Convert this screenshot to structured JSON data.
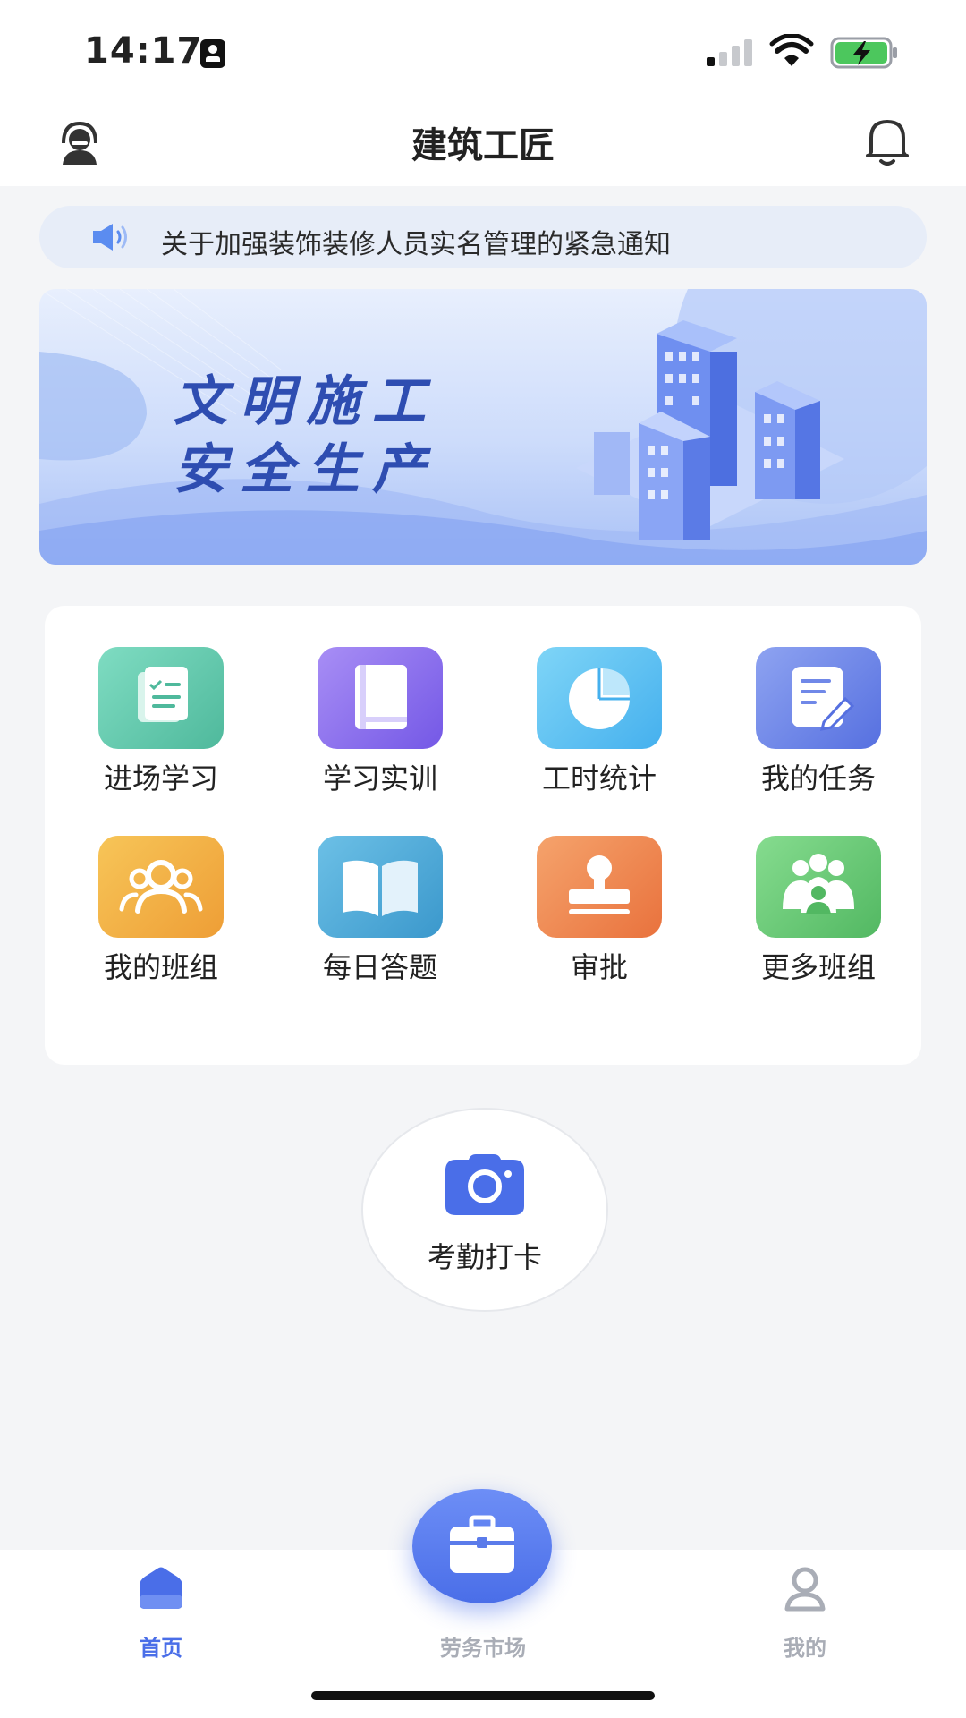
{
  "status_bar": {
    "time": "14:17"
  },
  "header": {
    "title": "建筑工匠",
    "left_icon": "customer-service-icon",
    "right_icon": "bell-icon"
  },
  "notice": {
    "icon": "speaker-icon",
    "text": "关于加强装饰装修人员实名管理的紧急通知"
  },
  "banner": {
    "line1": "文明施工",
    "line2": "安全生产"
  },
  "menu": [
    {
      "label": "进场学习",
      "icon": "checklist-doc-icon",
      "color": "#63c9ad"
    },
    {
      "label": "学习实训",
      "icon": "book-icon",
      "color": "#8a6ff0"
    },
    {
      "label": "工时统计",
      "icon": "pie-chart-icon",
      "color": "#5fc3f4"
    },
    {
      "label": "我的任务",
      "icon": "edit-note-icon",
      "color": "#6d86ea"
    },
    {
      "label": "我的班组",
      "icon": "group-icon",
      "color": "#f2ac45"
    },
    {
      "label": "每日答题",
      "icon": "open-book-icon",
      "color": "#4ca8d6"
    },
    {
      "label": "审批",
      "icon": "stamp-icon",
      "color": "#ef8750"
    },
    {
      "label": "更多班组",
      "icon": "team-icon",
      "color": "#6ccb7c"
    }
  ],
  "checkin": {
    "label": "考勤打卡",
    "icon": "camera-icon"
  },
  "tabbar": {
    "items": [
      {
        "label": "首页",
        "icon": "home-icon",
        "active": true,
        "color": "#4a6ee8"
      },
      {
        "label": "劳务市场",
        "icon": "briefcase-icon",
        "active": false,
        "color": "#a9adb6"
      },
      {
        "label": "我的",
        "icon": "user-icon",
        "active": false,
        "color": "#a9adb6"
      }
    ]
  }
}
